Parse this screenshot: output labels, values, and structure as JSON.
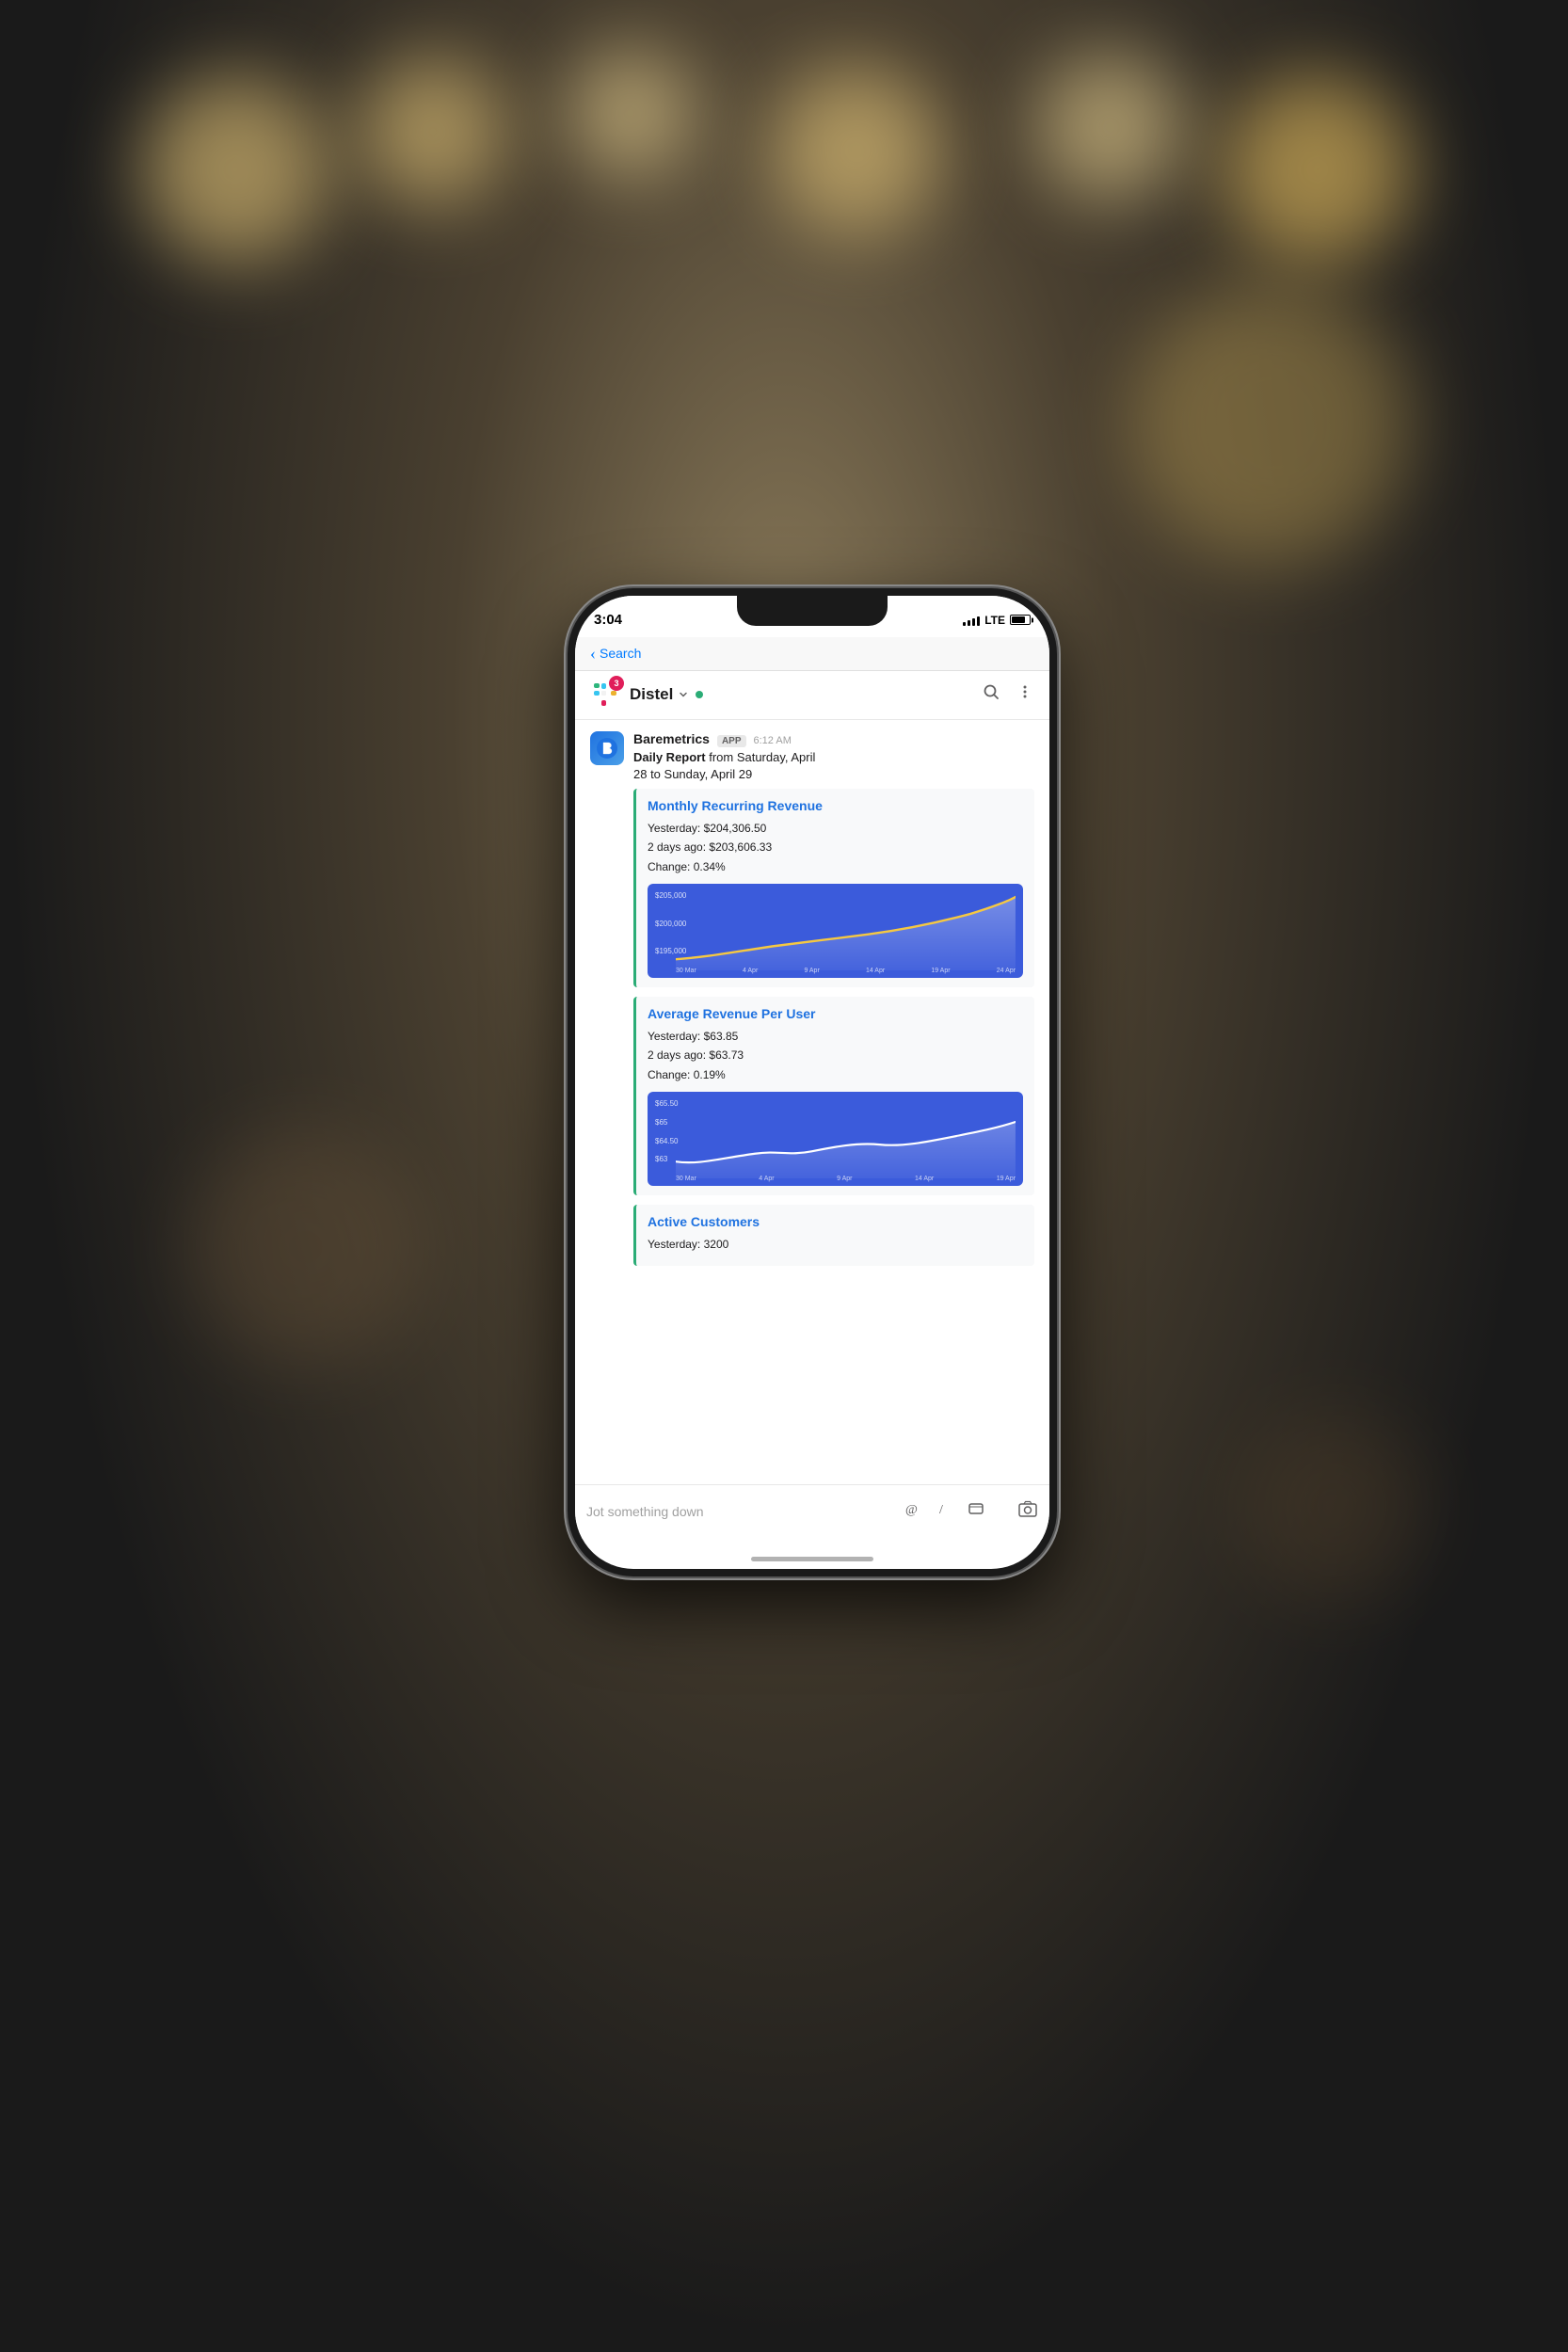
{
  "phone": {
    "status_bar": {
      "time": "3:04",
      "signal": "LTE",
      "battery": 80
    },
    "nav": {
      "back_label": "Search"
    },
    "header": {
      "channel_name": "Distel",
      "badge_count": "3",
      "status_color": "#2bac76"
    },
    "message": {
      "sender": "Baremetrics",
      "app_badge": "APP",
      "time": "6:12 AM",
      "body_line1": "Daily Report",
      "body_from": "from Saturday, April",
      "body_date": "28 to Sunday, April 29"
    },
    "metrics": [
      {
        "id": "mrr",
        "title": "Monthly Recurring Revenue",
        "yesterday_label": "Yesterday:",
        "yesterday_value": "$204,306.50",
        "two_days_label": "2 days ago:",
        "two_days_value": "$203,606.33",
        "change_label": "Change:",
        "change_value": "0.34%",
        "chart": {
          "y_labels": [
            "$205,000",
            "$200,000",
            "$195,000"
          ],
          "x_labels": [
            "30 Mar",
            "4 Apr",
            "9 Apr",
            "14 Apr",
            "19 Apr",
            "24 Apr"
          ],
          "line_color": "#f5c842",
          "bg_color": "#3b5bdb"
        }
      },
      {
        "id": "arpu",
        "title": "Average Revenue Per User",
        "yesterday_label": "Yesterday:",
        "yesterday_value": "$63.85",
        "two_days_label": "2 days ago:",
        "two_days_value": "$63.73",
        "change_label": "Change:",
        "change_value": "0.19%",
        "chart": {
          "y_labels": [
            "$65.50",
            "$65",
            "$64.50",
            "$63"
          ],
          "x_labels": [
            "30 Mar",
            "4 Apr",
            "9 Apr",
            "14 Apr",
            "19 Apr"
          ],
          "bg_color": "#3b5bdb"
        }
      },
      {
        "id": "active-customers",
        "title": "Active Customers",
        "yesterday_label": "Yesterday:",
        "yesterday_value": "3200"
      }
    ],
    "input_bar": {
      "placeholder": "Jot something down"
    }
  }
}
